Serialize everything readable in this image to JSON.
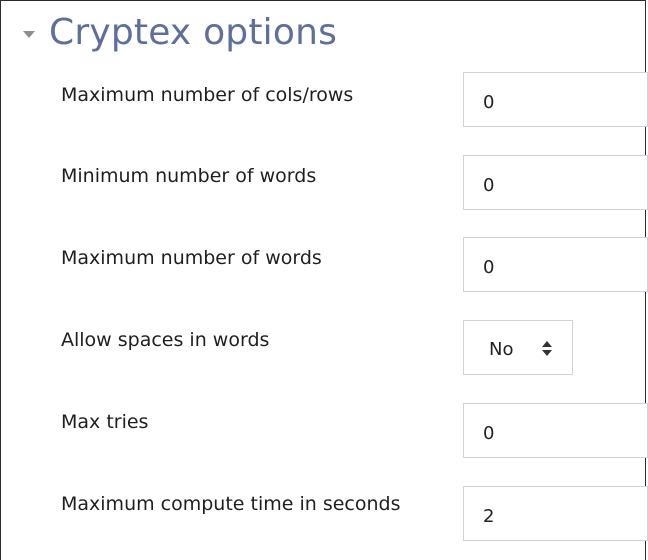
{
  "section": {
    "title": "Cryptex options",
    "expanded": true
  },
  "fields": {
    "max_cols_rows": {
      "label": "Maximum number of cols/rows",
      "value": "0"
    },
    "min_words": {
      "label": "Minimum number of words",
      "value": "0"
    },
    "max_words": {
      "label": "Maximum number of words",
      "value": "0"
    },
    "allow_spaces": {
      "label": "Allow spaces in words",
      "value": "No"
    },
    "max_tries": {
      "label": "Max tries",
      "value": "0"
    },
    "max_compute_time": {
      "label": "Maximum compute time in seconds",
      "value": "2"
    }
  },
  "colors": {
    "title": "#5f6f9b",
    "caret": "#8e8e8e",
    "input_border": "#cfd4da",
    "frame_border": "#2b2b2b"
  }
}
